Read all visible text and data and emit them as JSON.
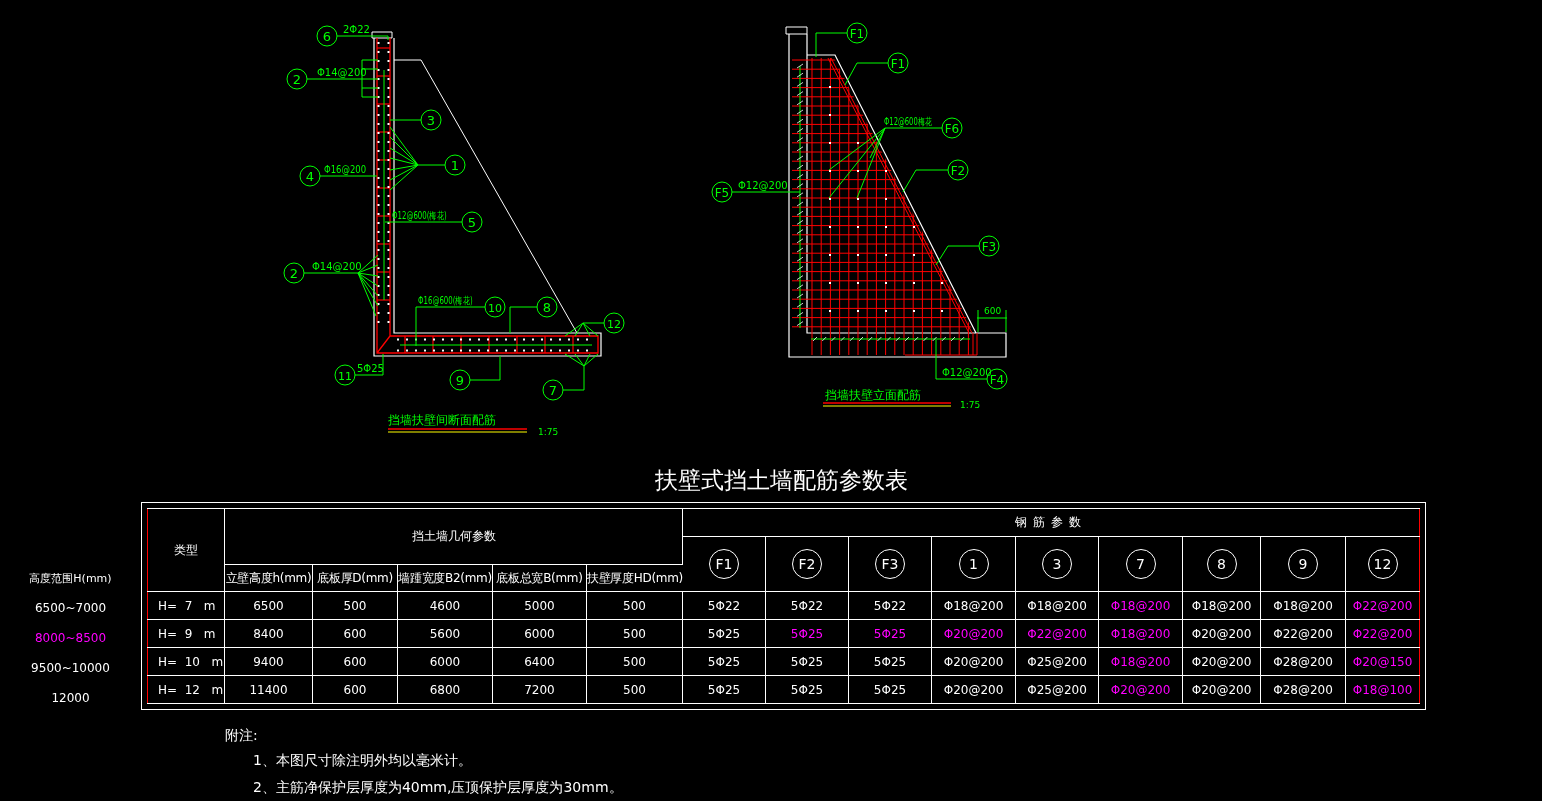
{
  "section_drawing": {
    "title": "挡墙扶壁间断面配筋",
    "scale": "1:75",
    "callouts": [
      {
        "label": "6",
        "note": "2Φ22"
      },
      {
        "label": "2",
        "note": "Φ14@200"
      },
      {
        "label": "3"
      },
      {
        "label": "1"
      },
      {
        "label": "4",
        "note": "Φ16@200"
      },
      {
        "label": "5",
        "note": "Φ12@600(梅花)"
      },
      {
        "label": "2",
        "note": "Φ14@200"
      },
      {
        "label": "10",
        "note": "Φ16@600(梅花)"
      },
      {
        "label": "8"
      },
      {
        "label": "12"
      },
      {
        "label": "11",
        "note": "5Φ25"
      },
      {
        "label": "9"
      },
      {
        "label": "7"
      }
    ]
  },
  "elevation_drawing": {
    "title": "挡墙扶壁立面配筋",
    "scale": "1:75",
    "dimension": "600",
    "callouts": [
      {
        "label": "F1"
      },
      {
        "label": "F1"
      },
      {
        "label": "F6",
        "note": "Φ12@600梅花"
      },
      {
        "label": "F2"
      },
      {
        "label": "F5",
        "note": "Φ12@200"
      },
      {
        "label": "F3"
      },
      {
        "label": "F4",
        "note": "Φ12@200"
      }
    ]
  },
  "table_title": "扶壁式挡土墙配筋参数表",
  "height_ranges": {
    "heading": "高度范围H(mm)",
    "items": [
      {
        "text": "6500~7000",
        "highlighted": false
      },
      {
        "text": "8000~8500",
        "highlighted": true
      },
      {
        "text": "9500~10000",
        "highlighted": false
      },
      {
        "text": "12000",
        "highlighted": false
      }
    ]
  },
  "table": {
    "type_heading": "类型",
    "geometry_heading": "挡土墙几何参数",
    "rebar_heading": "钢筋参数",
    "geometry_columns": [
      "立壁高度h(mm)",
      "底板厚D(mm)",
      "墙踵宽度B2(mm)",
      "底板总宽B(mm)",
      "扶壁厚度HD(mm)"
    ],
    "rebar_columns": [
      "F1",
      "F2",
      "F3",
      "1",
      "3",
      "7",
      "8",
      "9",
      "12"
    ],
    "rows": [
      {
        "type": "H=  7   m",
        "geometry": [
          "6500",
          "500",
          "4600",
          "5000",
          "500"
        ],
        "rebar": [
          {
            "text": "5Φ22",
            "highlighted": false
          },
          {
            "text": "5Φ22",
            "highlighted": false
          },
          {
            "text": "5Φ22",
            "highlighted": false
          },
          {
            "text": "Φ18@200",
            "highlighted": false
          },
          {
            "text": "Φ18@200",
            "highlighted": false
          },
          {
            "text": "Φ18@200",
            "highlighted": true
          },
          {
            "text": "Φ18@200",
            "highlighted": false
          },
          {
            "text": "Φ18@200",
            "highlighted": false
          },
          {
            "text": "Φ22@200",
            "highlighted": true
          }
        ]
      },
      {
        "type": "H=  9   m",
        "geometry": [
          "8400",
          "600",
          "5600",
          "6000",
          "500"
        ],
        "rebar": [
          {
            "text": "5Φ25",
            "highlighted": false
          },
          {
            "text": "5Φ25",
            "highlighted": true
          },
          {
            "text": "5Φ25",
            "highlighted": true
          },
          {
            "text": "Φ20@200",
            "highlighted": true
          },
          {
            "text": "Φ22@200",
            "highlighted": true
          },
          {
            "text": "Φ18@200",
            "highlighted": true
          },
          {
            "text": "Φ20@200",
            "highlighted": false
          },
          {
            "text": "Φ22@200",
            "highlighted": false
          },
          {
            "text": "Φ22@200",
            "highlighted": true
          }
        ]
      },
      {
        "type": "H=  10   m",
        "geometry": [
          "9400",
          "600",
          "6000",
          "6400",
          "500"
        ],
        "rebar": [
          {
            "text": "5Φ25",
            "highlighted": false
          },
          {
            "text": "5Φ25",
            "highlighted": false
          },
          {
            "text": "5Φ25",
            "highlighted": false
          },
          {
            "text": "Φ20@200",
            "highlighted": false
          },
          {
            "text": "Φ25@200",
            "highlighted": false
          },
          {
            "text": "Φ18@200",
            "highlighted": true
          },
          {
            "text": "Φ20@200",
            "highlighted": false
          },
          {
            "text": "Φ28@200",
            "highlighted": false
          },
          {
            "text": "Φ20@150",
            "highlighted": true
          }
        ]
      },
      {
        "type": "H=  12   m",
        "geometry": [
          "11400",
          "600",
          "6800",
          "7200",
          "500"
        ],
        "rebar": [
          {
            "text": "5Φ25",
            "highlighted": false
          },
          {
            "text": "5Φ25",
            "highlighted": false
          },
          {
            "text": "5Φ25",
            "highlighted": false
          },
          {
            "text": "Φ20@200",
            "highlighted": false
          },
          {
            "text": "Φ25@200",
            "highlighted": false
          },
          {
            "text": "Φ20@200",
            "highlighted": true
          },
          {
            "text": "Φ20@200",
            "highlighted": false
          },
          {
            "text": "Φ28@200",
            "highlighted": false
          },
          {
            "text": "Φ18@100",
            "highlighted": true
          }
        ]
      }
    ]
  },
  "notes": {
    "heading": "附注:",
    "items": [
      "1、本图尺寸除注明外均以毫米计。",
      "2、主筋净保护层厚度为40mm,压顶保护层厚度为30mm。"
    ]
  }
}
